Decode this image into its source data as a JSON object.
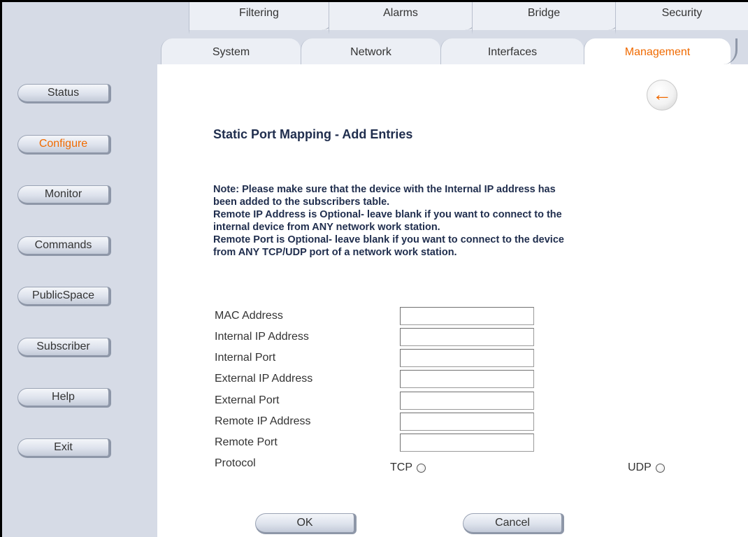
{
  "tabs_top": [
    {
      "label": "Filtering"
    },
    {
      "label": "Alarms"
    },
    {
      "label": "Bridge"
    },
    {
      "label": "Security"
    }
  ],
  "tabs_main": [
    {
      "label": "System"
    },
    {
      "label": "Network"
    },
    {
      "label": "Interfaces"
    },
    {
      "label": "Management",
      "active": true
    }
  ],
  "sidebar": {
    "items": [
      {
        "label": "Status"
      },
      {
        "label": "Configure",
        "active": true
      },
      {
        "label": "Monitor"
      },
      {
        "label": "Commands"
      },
      {
        "label": "PublicSpace"
      },
      {
        "label": "Subscriber"
      },
      {
        "label": "Help"
      },
      {
        "label": "Exit"
      }
    ]
  },
  "page": {
    "back_icon": "back-arrow-icon",
    "back_glyph": "←",
    "title": "Static Port Mapping - Add Entries",
    "note_lines": [
      "Note: Please make sure that the device with the Internal IP address has",
      "been added to the subscribers table.",
      "Remote IP Address is Optional- leave blank if you want to connect to the",
      "internal device from ANY network work station.",
      "Remote Port is Optional- leave blank if you want to connect to the device",
      "from ANY TCP/UDP port of a network work station."
    ]
  },
  "form": {
    "fields": [
      {
        "label": "MAC Address",
        "value": ""
      },
      {
        "label": "Internal IP Address",
        "value": ""
      },
      {
        "label": "Internal Port",
        "value": ""
      },
      {
        "label": "External IP Address",
        "value": ""
      },
      {
        "label": "External Port",
        "value": ""
      },
      {
        "label": "Remote IP Address",
        "value": ""
      },
      {
        "label": "Remote Port",
        "value": ""
      }
    ],
    "protocol_label": "Protocol",
    "protocol_options": [
      {
        "label": "TCP",
        "selected": false
      },
      {
        "label": "UDP",
        "selected": false
      }
    ],
    "ok_label": "OK",
    "cancel_label": "Cancel"
  },
  "colors": {
    "accent": "#f06a00",
    "sidebar_bg": "#d6dbe6",
    "title_text": "#1f2d4d"
  }
}
